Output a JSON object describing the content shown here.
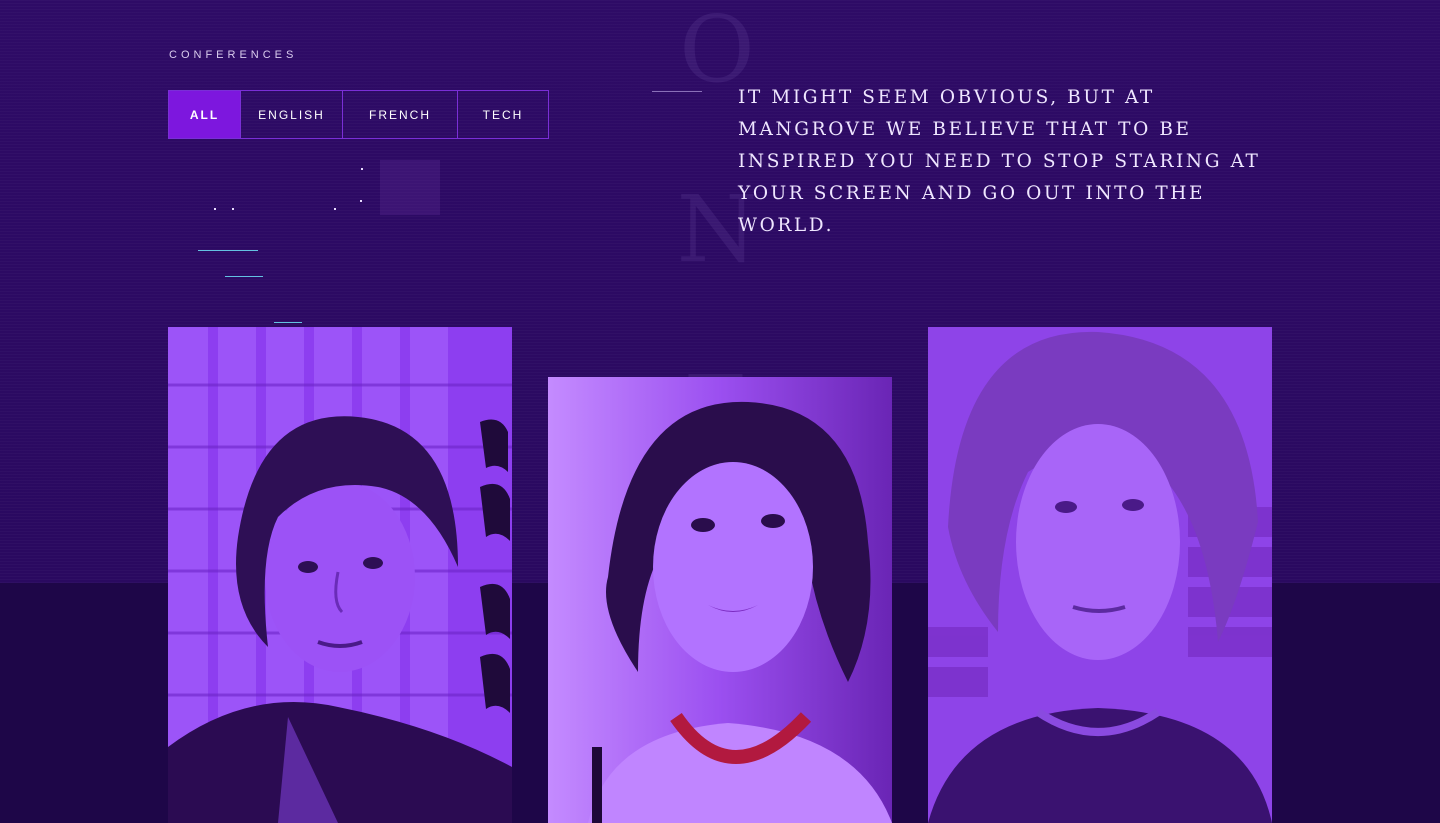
{
  "section": {
    "label": "CONFERENCES"
  },
  "filters": [
    {
      "label": "ALL",
      "active": true
    },
    {
      "label": "ENGLISH",
      "active": false
    },
    {
      "label": "FRENCH",
      "active": false
    },
    {
      "label": "TECH",
      "active": false
    }
  ],
  "quote": {
    "text": "It might seem obvious, but at Mangrove we believe that to be inspired you need to stop staring at your screen and go out into the world."
  },
  "background_word": {
    "letters": [
      "O",
      "N",
      "E"
    ]
  },
  "speakers": [
    {
      "photo_icon": "speaker-photo-man-dark-hair"
    },
    {
      "photo_icon": "speaker-photo-woman-short-hair"
    },
    {
      "photo_icon": "speaker-photo-man-light-hair"
    }
  ],
  "colors": {
    "background": "#2a0a5e",
    "accent": "#7d17de",
    "tab_border": "#7a2fd6",
    "photo_tint": "#8a2be2"
  }
}
